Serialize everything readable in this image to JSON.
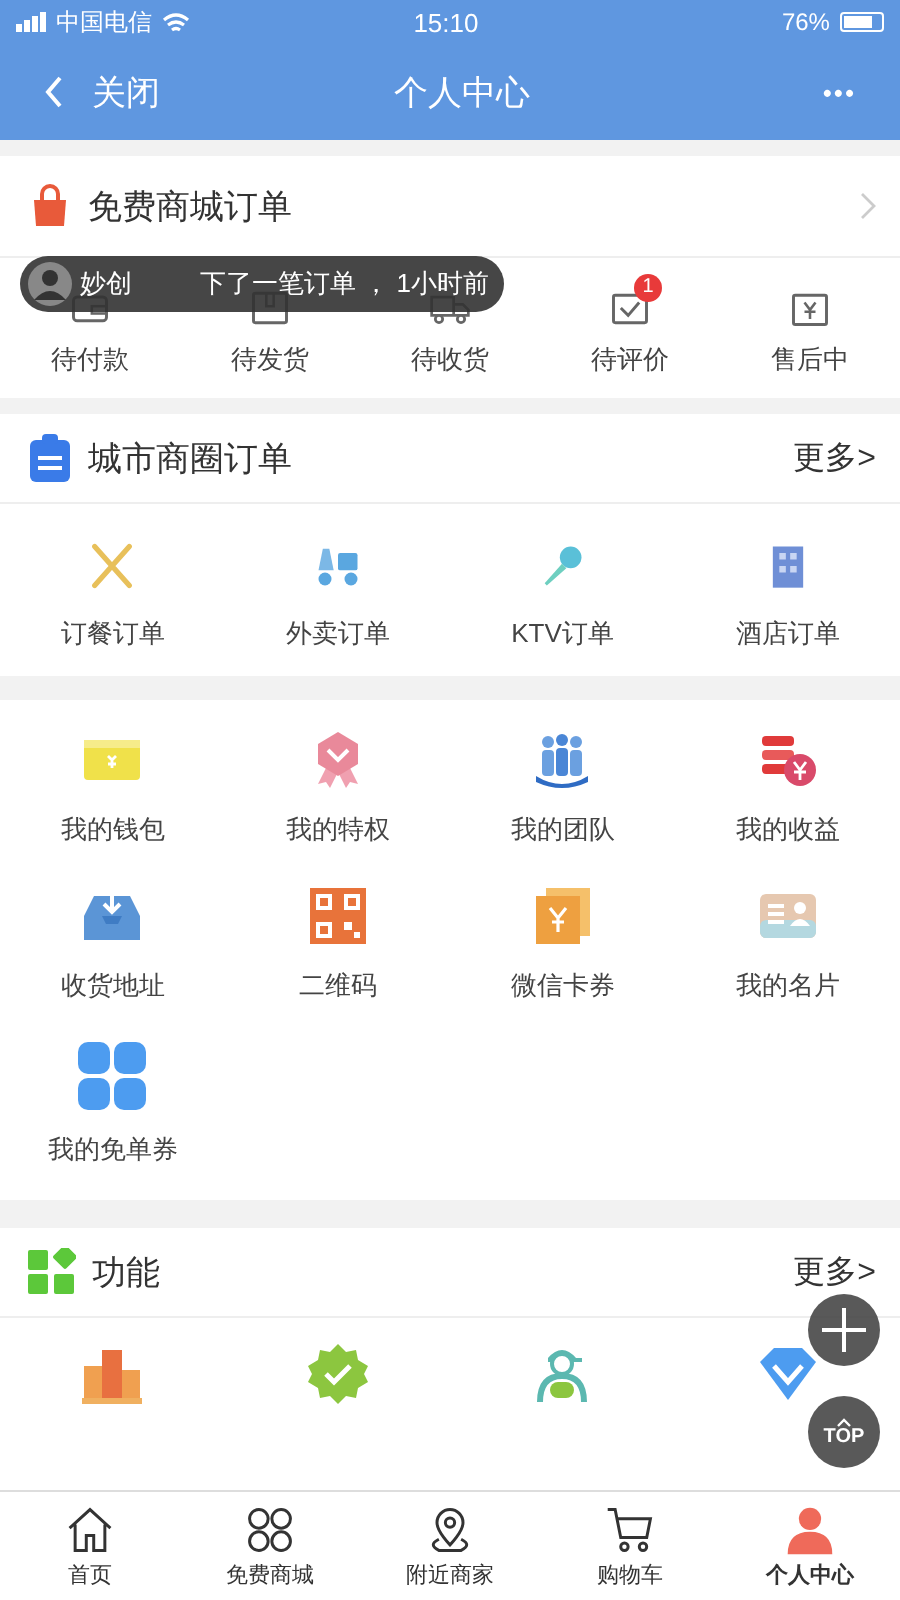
{
  "status_bar": {
    "carrier": "中国电信",
    "time": "15:10",
    "battery": "76%"
  },
  "nav": {
    "back": "关闭",
    "title": "个人中心",
    "more": "•••"
  },
  "mall_orders": {
    "title": "免费商城订单",
    "items": [
      {
        "label": "待付款"
      },
      {
        "label": "待发货"
      },
      {
        "label": "待收货"
      },
      {
        "label": "待评价",
        "badge": "1"
      },
      {
        "label": "售后中"
      }
    ]
  },
  "toast": {
    "user": "妙创",
    "message": "下了一笔订单 ， 1小时前"
  },
  "city_orders": {
    "title": "城市商圈订单",
    "more": "更多>",
    "items": [
      {
        "label": "订餐订单"
      },
      {
        "label": "外卖订单"
      },
      {
        "label": "KTV订单"
      },
      {
        "label": "酒店订单"
      }
    ]
  },
  "services": [
    {
      "label": "我的钱包"
    },
    {
      "label": "我的特权"
    },
    {
      "label": "我的团队"
    },
    {
      "label": "我的收益"
    },
    {
      "label": "收货地址"
    },
    {
      "label": "二维码"
    },
    {
      "label": "微信卡券"
    },
    {
      "label": "我的名片"
    },
    {
      "label": "我的免单券"
    }
  ],
  "functions": {
    "title": "功能",
    "more": "更多>"
  },
  "floating": {
    "top": "TOP"
  },
  "tab_bar": [
    {
      "label": "首页",
      "selected": false
    },
    {
      "label": "免费商城",
      "selected": false
    },
    {
      "label": "附近商家",
      "selected": false
    },
    {
      "label": "购物车",
      "selected": false
    },
    {
      "label": "个人中心",
      "selected": true
    }
  ]
}
